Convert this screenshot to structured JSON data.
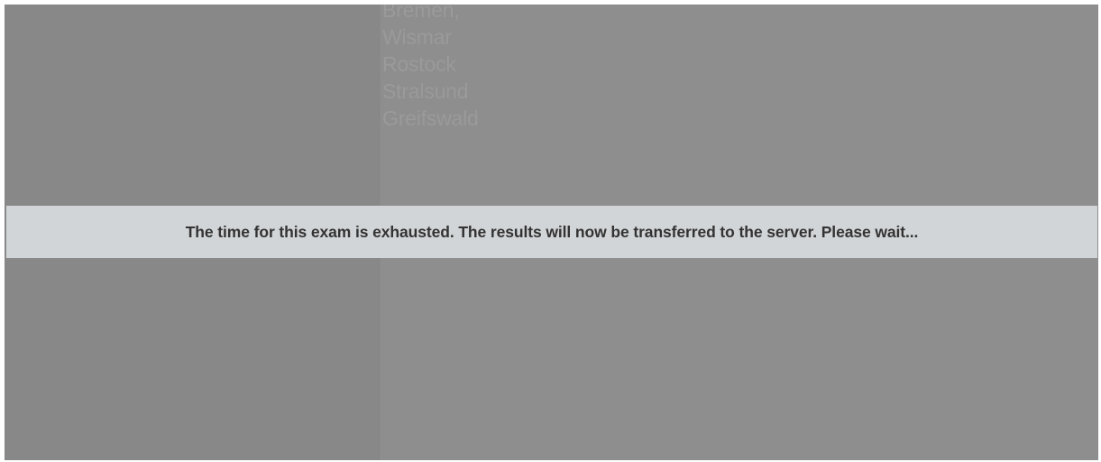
{
  "background_list": {
    "items": [
      "Bremen,",
      "Wismar",
      "Rostock",
      "Stralsund",
      "Greifswald"
    ]
  },
  "banner": {
    "message": "The time for this exam is exhausted. The results will now be transferred to the server. Please wait..."
  },
  "colors": {
    "overlay": "#8c8c8c",
    "banner_bg": "#d2d5d7",
    "banner_text": "#333333"
  }
}
